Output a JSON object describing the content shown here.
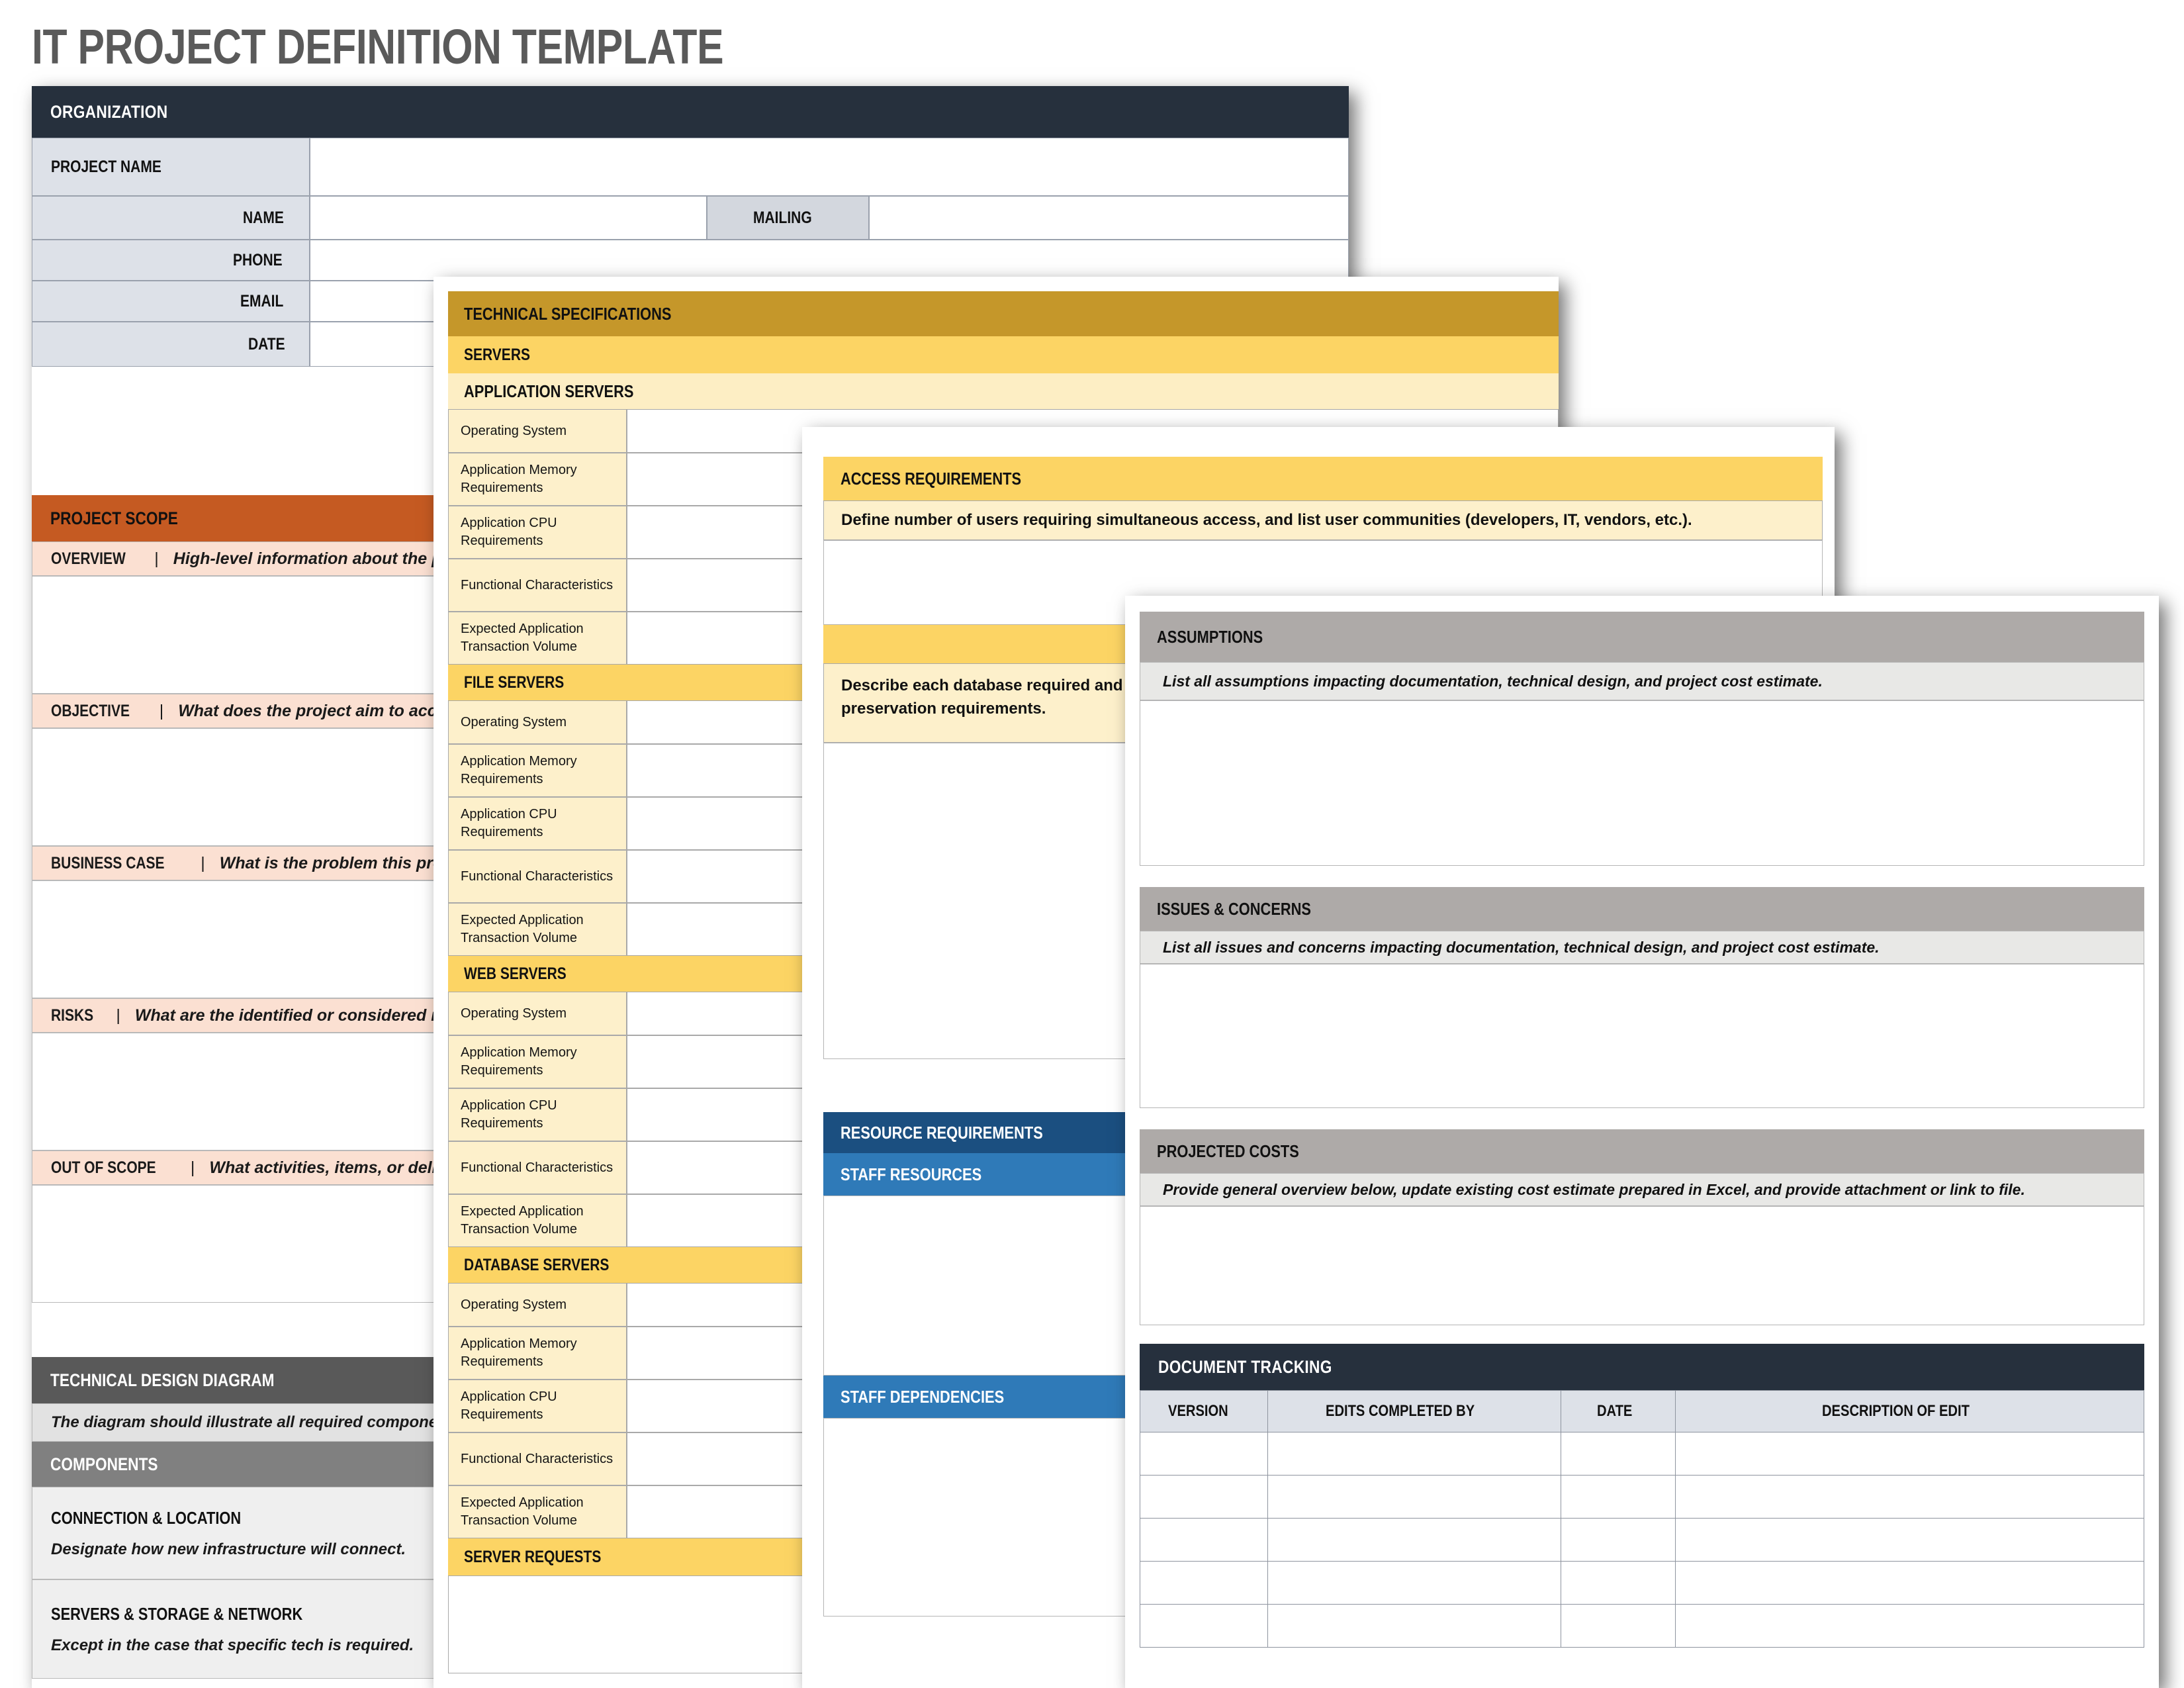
{
  "page": {
    "title": "IT PROJECT DEFINITION TEMPLATE"
  },
  "card_organization": {
    "header": "ORGANIZATION",
    "rows": [
      {
        "label": "PROJECT NAME",
        "value": ""
      },
      {
        "label": "NAME",
        "value": ""
      },
      {
        "label": "PHONE",
        "value": ""
      },
      {
        "label": "EMAIL",
        "value": ""
      },
      {
        "label": "DATE",
        "value": ""
      }
    ],
    "mailing_label": "MAILING"
  },
  "card_scope": {
    "header": "PROJECT SCOPE",
    "sections": [
      {
        "label": "OVERVIEW",
        "sep": "|",
        "prompt": "High-level information about the project.",
        "value": ""
      },
      {
        "label": "OBJECTIVE",
        "sep": "|",
        "prompt": "What does the project aim to accomplish?",
        "value": ""
      },
      {
        "label": "BUSINESS CASE",
        "sep": "|",
        "prompt": "What is the problem this project solves?",
        "value": ""
      },
      {
        "label": "RISKS",
        "sep": "|",
        "prompt": "What are the identified or considered risks?",
        "value": ""
      },
      {
        "label": "OUT OF SCOPE",
        "sep": "|",
        "prompt": "What activities, items, or deliverables are excluded?",
        "value": ""
      }
    ]
  },
  "card_design": {
    "header": "TECHNICAL DESIGN DIAGRAM",
    "note": "The diagram should illustrate all required components.",
    "components_header": "COMPONENTS",
    "components": [
      {
        "title": "CONNECTION & LOCATION",
        "desc": "Designate how new infrastructure will connect."
      },
      {
        "title": "SERVERS & STORAGE & NETWORK",
        "desc": "Except in the case that specific tech is required."
      }
    ]
  },
  "card_techspecs": {
    "header": "TECHNICAL SPECIFICATIONS",
    "servers_header": "SERVERS",
    "spec_fields": [
      "Operating System",
      "Application Memory Requirements",
      "Application CPU Requirements",
      "Functional Characteristics",
      "Expected Application Transaction Volume"
    ],
    "groups": [
      {
        "title": "APPLICATION SERVERS",
        "style": "sub"
      },
      {
        "title": "FILE SERVERS",
        "style": "gold"
      },
      {
        "title": "WEB SERVERS",
        "style": "gold"
      },
      {
        "title": "DATABASE SERVERS",
        "style": "gold"
      }
    ],
    "footer_group": "SERVER REQUESTS"
  },
  "card_access": {
    "header": "ACCESS REQUIREMENTS",
    "note": "Define number of users requiring simultaneous access, and list user communities (developers, IT, vendors, etc.).",
    "value": "",
    "db_note": "Describe each database required and its memory and CPU requirements, storage amount needed, as well as any special data preservation requirements.",
    "db_value": "",
    "resource_header": "RESOURCE REQUIREMENTS",
    "staff_resources_header": "STAFF RESOURCES",
    "staff_resources_value": "",
    "staff_dependencies_header": "STAFF DEPENDENCIES",
    "staff_dependencies_value": ""
  },
  "card_summary": {
    "assumptions": {
      "header": "ASSUMPTIONS",
      "note": "List all assumptions impacting documentation, technical design, and project cost estimate.",
      "value": ""
    },
    "issues": {
      "header": "ISSUES & CONCERNS",
      "note": "List all issues and concerns impacting documentation, technical design, and project cost estimate.",
      "value": ""
    },
    "costs": {
      "header": "PROJECTED COSTS",
      "note": "Provide general overview below, update existing cost estimate prepared in Excel, and provide attachment or link to file.",
      "value": ""
    },
    "tracking": {
      "header": "DOCUMENT TRACKING",
      "columns": [
        "VERSION",
        "EDITS COMPLETED BY",
        "DATE",
        "DESCRIPTION OF EDIT"
      ],
      "rows": [
        [
          "",
          "",
          "",
          ""
        ],
        [
          "",
          "",
          "",
          ""
        ],
        [
          "",
          "",
          "",
          ""
        ],
        [
          "",
          "",
          "",
          ""
        ],
        [
          "",
          "",
          "",
          ""
        ]
      ]
    }
  },
  "colors": {
    "dark_navy": "#26303d",
    "orange": "#c55a22",
    "peach": "#fbe0d2",
    "gold_dark": "#c5972a",
    "gold": "#fcd464",
    "cream": "#fdf0cb",
    "blue_dark": "#1b4f80",
    "blue": "#2f7ab8",
    "grey": "#aeaaa8",
    "title_grey": "#5a5a5a"
  }
}
